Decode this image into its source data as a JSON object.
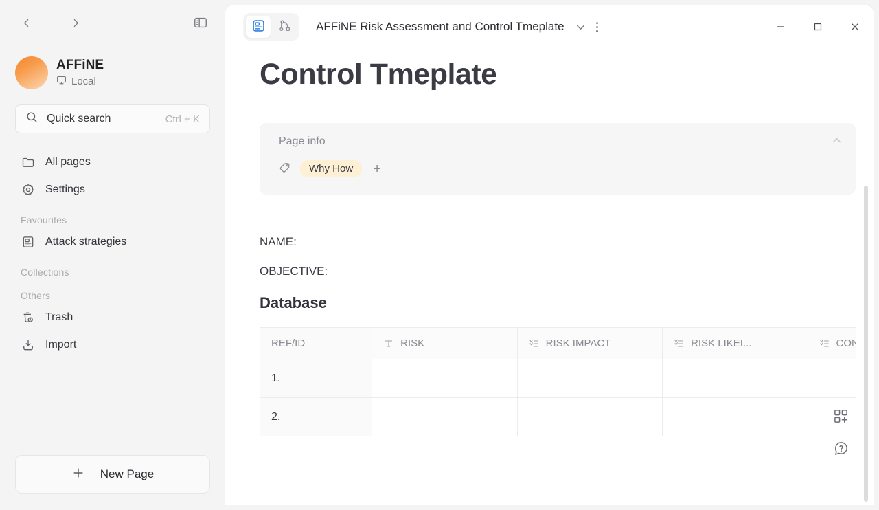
{
  "sidebar": {
    "nav_back": "Back",
    "nav_forward": "Forward",
    "toggle_sidebar": "Collapse sidebar",
    "workspace": {
      "name": "AFFiNE",
      "sync_status": "Local"
    },
    "search": {
      "label": "Quick search",
      "shortcut": "Ctrl + K"
    },
    "primary_items": [
      {
        "label": "All pages",
        "icon": "folder-icon"
      },
      {
        "label": "Settings",
        "icon": "gear-icon"
      }
    ],
    "sections": [
      {
        "label": "Favourites",
        "items": [
          {
            "label": "Attack strategies",
            "icon": "page-icon"
          }
        ]
      },
      {
        "label": "Collections",
        "items": []
      },
      {
        "label": "Others",
        "items": [
          {
            "label": "Trash",
            "icon": "trash-icon"
          },
          {
            "label": "Import",
            "icon": "import-icon"
          }
        ]
      }
    ],
    "new_page_label": "New Page"
  },
  "titlebar": {
    "mode_page": "Page mode",
    "mode_edgeless": "Edgeless mode",
    "doc_title": "AFFiNE Risk Assessment and Control Tmeplate",
    "chevron": "Switch doc",
    "more": "More options",
    "minimize": "Minimize",
    "maximize": "Maximize",
    "close": "Close"
  },
  "document": {
    "heading": "Control Tmeplate",
    "page_info": {
      "title": "Page info",
      "tags": [
        {
          "label": "Why How",
          "color": "#fdf0d5"
        }
      ],
      "add_tag": "+",
      "collapse": "Collapse"
    },
    "paragraphs": [
      "NAME:",
      "OBJECTIVE:"
    ],
    "subheading": "Database",
    "table": {
      "columns": [
        {
          "label": "REF/ID",
          "icon": ""
        },
        {
          "label": "RISK",
          "icon": "text-icon"
        },
        {
          "label": "RISK IMPACT",
          "icon": "select-icon"
        },
        {
          "label": "RISK LIKEI...",
          "icon": "select-icon"
        },
        {
          "label": "CONTROL DESCRIP",
          "icon": "select-icon"
        }
      ],
      "rows": [
        {
          "cells": [
            "1.",
            "",
            "",
            "",
            ""
          ]
        },
        {
          "cells": [
            "2.",
            "",
            "",
            "",
            ""
          ]
        }
      ]
    },
    "tools": [
      {
        "name": "add-block-icon",
        "label": "Add block"
      },
      {
        "name": "help-icon",
        "label": "Help"
      }
    ]
  },
  "colors": {
    "accent_blue": "#2e7fe8",
    "tag_bg": "#fdf0d5",
    "sidebar_bg": "#f4f4f4",
    "panel_bg": "#ffffff"
  }
}
